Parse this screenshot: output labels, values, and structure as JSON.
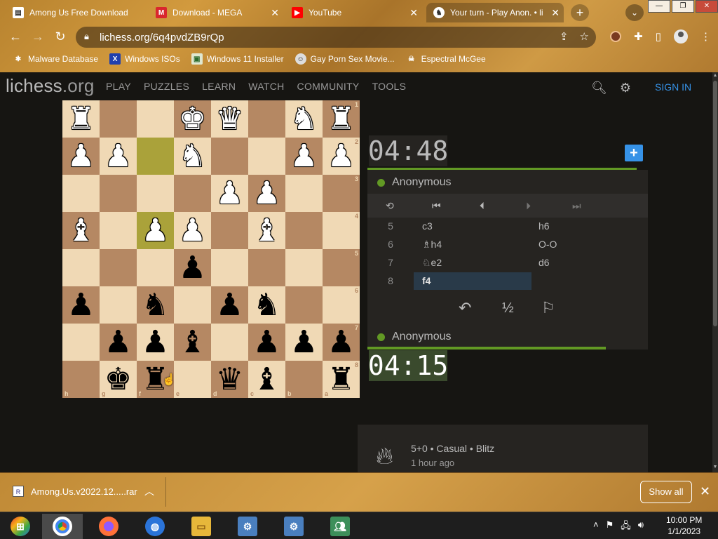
{
  "browser": {
    "tabs": [
      {
        "title": "Among Us Free Download",
        "icon": "file-icon",
        "color": "#ffffff"
      },
      {
        "title": "Download - MEGA",
        "icon": "mega-icon",
        "color": "#d9272e"
      },
      {
        "title": "YouTube",
        "icon": "youtube-icon",
        "color": "#ff0000"
      },
      {
        "title": "Your turn - Play Anon. • li",
        "icon": "lichess-icon",
        "color": "#ffffff"
      }
    ],
    "url": "lichess.org/6q4pvdZB9rQp",
    "bookmarks": [
      {
        "label": "Malware Database",
        "icon": "bug-icon"
      },
      {
        "label": "Windows ISOs",
        "icon": "x-icon"
      },
      {
        "label": "Windows 11 Installer",
        "icon": "image-icon"
      },
      {
        "label": "Gay Porn Sex Movie...",
        "icon": "face-icon"
      },
      {
        "label": "Espectral McGee",
        "icon": "skull-icon"
      }
    ]
  },
  "site": {
    "logo_main": "lichess",
    "logo_suffix": ".org",
    "nav": [
      "PLAY",
      "PUZZLES",
      "LEARN",
      "WATCH",
      "COMMUNITY",
      "TOOLS"
    ],
    "signin": "SIGN IN",
    "colors": {
      "accent": "#3692e7",
      "green": "#629924",
      "board_light": "#f0d9b5",
      "board_dark": "#b58863",
      "highlight": "#aaa23a"
    }
  },
  "board": {
    "rank_labels": [
      "1",
      "2",
      "3",
      "4",
      "5",
      "6",
      "7",
      "8"
    ],
    "file_labels": [
      "h",
      "g",
      "f",
      "e",
      "d",
      "c",
      "b",
      "a"
    ],
    "rows": [
      [
        "wR",
        "",
        "",
        "wK",
        "wQ",
        "",
        "wN",
        "wR"
      ],
      [
        "wP",
        "wP",
        "",
        "wN",
        "",
        "",
        "wP",
        "wP"
      ],
      [
        "",
        "",
        "",
        "",
        "wP",
        "wP",
        "",
        ""
      ],
      [
        "wB",
        "",
        "wP",
        "wP",
        "",
        "wB",
        "",
        ""
      ],
      [
        "",
        "",
        "",
        "bP",
        "",
        "",
        "",
        ""
      ],
      [
        "bP",
        "",
        "bN",
        "",
        "bP",
        "bN",
        "",
        ""
      ],
      [
        "",
        "bP",
        "bP",
        "bB",
        "",
        "bP",
        "bP",
        "bP"
      ],
      [
        "",
        "bK",
        "bR",
        "",
        "bQ",
        "bB",
        "",
        "bR"
      ]
    ],
    "highlights": [
      [
        1,
        2
      ],
      [
        3,
        2
      ]
    ]
  },
  "game": {
    "opponent_clock": "04:48",
    "player_clock": "04:15",
    "opponent_name": "Anonymous",
    "player_name": "Anonymous",
    "opponent_time_fraction": 0.96,
    "player_time_fraction": 0.85,
    "moves": [
      {
        "num": "5",
        "white": "c3",
        "black": "h6"
      },
      {
        "num": "6",
        "white": "♗h4",
        "black": "O-O"
      },
      {
        "num": "7",
        "white": "♘e2",
        "black": "d6"
      },
      {
        "num": "8",
        "white": "f4",
        "black": ""
      }
    ],
    "active_move": "f4",
    "draw_label": "½",
    "info_line1": "5+0 • Casual • Blitz",
    "info_line2": "1 hour ago"
  },
  "download_bar": {
    "filename": "Among.Us.v2022.12.....rar",
    "show_all": "Show all"
  },
  "taskbar": {
    "time": "10:00 PM",
    "date": "1/1/2023"
  }
}
